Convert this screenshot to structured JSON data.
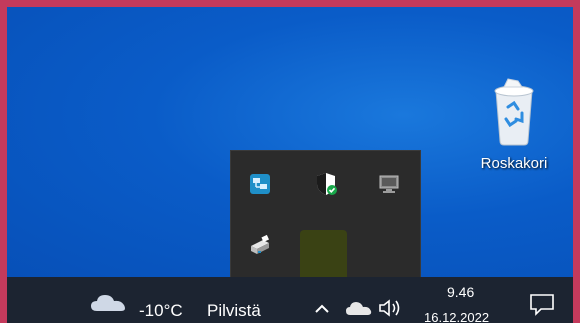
{
  "desktop": {
    "recycle_bin_label": "Roskakori"
  },
  "tray_popup": {
    "icons": [
      "network-app-icon",
      "security-shield-icon",
      "monitor-icon",
      "printer-icon",
      "wifi-icon"
    ]
  },
  "taskbar": {
    "weather_temp": "-10°C",
    "weather_desc": "Pilvistä",
    "time": "9.46",
    "date": "16.12.2022"
  },
  "colors": {
    "desktop_blue": "#0a5cc8",
    "taskbar": "#1c2431",
    "popup": "#2b2b2b",
    "highlight": "#3a4214"
  }
}
